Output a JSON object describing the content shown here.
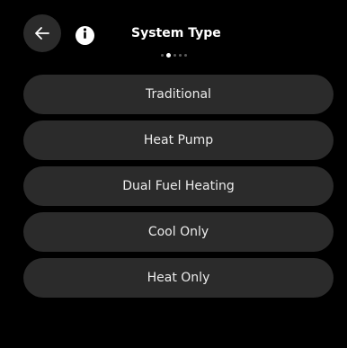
{
  "header": {
    "title": "System Type",
    "back_icon": "arrow-left-icon",
    "info_icon": "info-icon",
    "page_indicator": {
      "total": 5,
      "current": 2
    }
  },
  "options": [
    {
      "label": "Traditional"
    },
    {
      "label": "Heat Pump"
    },
    {
      "label": "Dual Fuel Heating"
    },
    {
      "label": "Cool Only"
    },
    {
      "label": "Heat Only"
    }
  ],
  "colors": {
    "background": "#000000",
    "button_fill": "#2b2b2b",
    "text": "#ffffff",
    "dot_inactive": "#5a5a5a"
  }
}
